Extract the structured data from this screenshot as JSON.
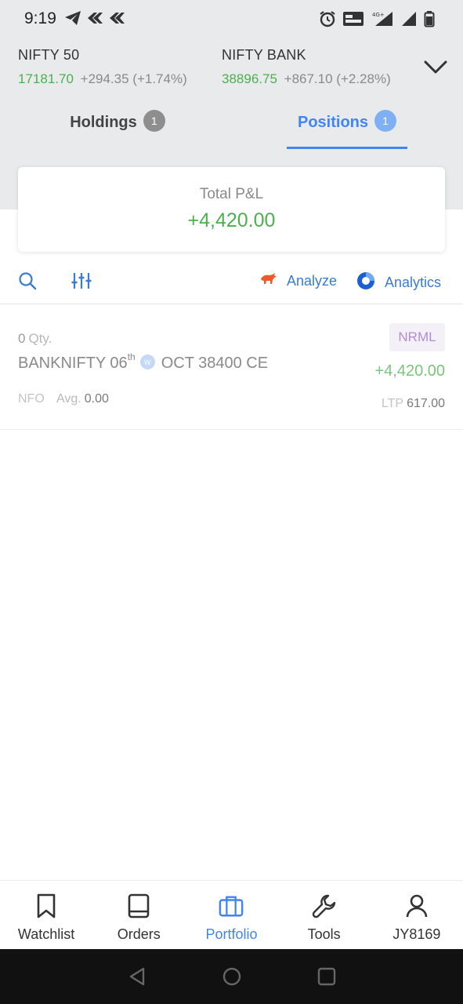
{
  "status_bar": {
    "time": "9:19",
    "left_icons": [
      "telegram-icon",
      "notification-icon",
      "notification-icon"
    ],
    "right_icons": [
      "alarm-icon",
      "volte-icon",
      "signal-4g-icon",
      "signal-icon",
      "battery-icon"
    ],
    "network_label": "4G+"
  },
  "indices": [
    {
      "name": "NIFTY 50",
      "value": "17181.70",
      "change": "+294.35 (+1.74%)"
    },
    {
      "name": "NIFTY BANK",
      "value": "38896.75",
      "change": "+867.10 (+2.28%)"
    }
  ],
  "tabs": [
    {
      "label": "Holdings",
      "count": "1",
      "active": false
    },
    {
      "label": "Positions",
      "count": "1",
      "active": true
    }
  ],
  "pnl": {
    "label": "Total P&L",
    "value": "+4,420.00"
  },
  "toolbar": {
    "analyze_label": "Analyze",
    "analytics_label": "Analytics"
  },
  "position": {
    "qty": "0",
    "qty_label": "Qty.",
    "product": "NRML",
    "symbol_prefix": "BANKNIFTY 06",
    "symbol_sup": "th",
    "weekly_badge": "W",
    "symbol_suffix": "OCT 38400 CE",
    "pnl": "+4,420.00",
    "exchange": "NFO",
    "avg_label": "Avg.",
    "avg_value": "0.00",
    "ltp_label": "LTP",
    "ltp_value": "617.00"
  },
  "bottom_nav": [
    {
      "label": "Watchlist",
      "icon": "bookmark-icon",
      "active": false
    },
    {
      "label": "Orders",
      "icon": "book-icon",
      "active": false
    },
    {
      "label": "Portfolio",
      "icon": "briefcase-icon",
      "active": true
    },
    {
      "label": "Tools",
      "icon": "wrench-icon",
      "active": false
    },
    {
      "label": "JY8169",
      "icon": "user-icon",
      "active": false
    }
  ],
  "colors": {
    "accent": "#4184f3",
    "profit": "#4caf50",
    "top_background": "#e9eaec",
    "product_tag": "#b08fcc"
  }
}
